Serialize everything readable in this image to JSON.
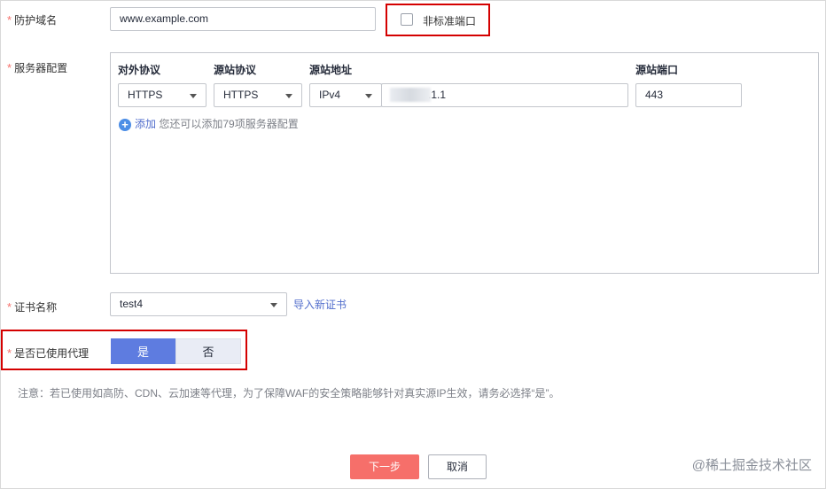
{
  "domain": {
    "label": "防护域名",
    "value": "www.example.com",
    "nonstandard_port_label": "非标准端口"
  },
  "server_config": {
    "label": "服务器配置",
    "columns": {
      "external_protocol": "对外协议",
      "origin_protocol": "源站协议",
      "origin_address": "源站地址",
      "origin_port": "源站端口"
    },
    "row": {
      "external_protocol": "HTTPS",
      "origin_protocol": "HTTPS",
      "ip_version": "IPv4",
      "address_suffix": ".1.1",
      "port": "443"
    },
    "add_link": "添加",
    "add_hint": "您还可以添加79项服务器配置"
  },
  "certificate": {
    "label": "证书名称",
    "value": "test4",
    "import_link": "导入新证书"
  },
  "proxy": {
    "label": "是否已使用代理",
    "yes": "是",
    "no": "否",
    "selected": "是"
  },
  "note": "注意：若已使用如高防、CDN、云加速等代理，为了保障WAF的安全策略能够针对真实源IP生效，请务必选择“是”。",
  "actions": {
    "next": "下一步",
    "cancel": "取消"
  },
  "watermark": "@稀土掘金技术社区",
  "colors": {
    "required_star": "#f66f6a",
    "highlight_box": "#d40000",
    "primary_toggle": "#5e7ce0",
    "next_button": "#f66f6a",
    "link": "#526ecc"
  }
}
